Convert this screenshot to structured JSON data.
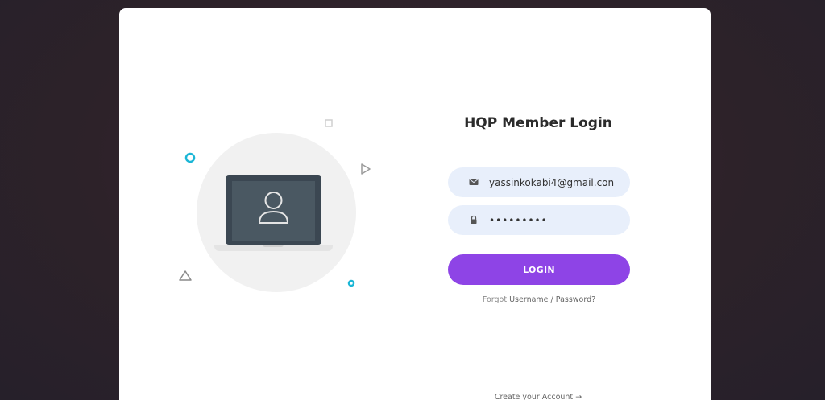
{
  "login": {
    "title": "HQP Member Login",
    "email_value": "yassinkokabi4@gmail.con",
    "password_value": "•••••••••",
    "login_label": "LOGIN",
    "forgot_prefix": "Forgot",
    "forgot_link": "Username / Password?",
    "create_account": "Create your Account",
    "create_arrow": "→"
  },
  "icons": {
    "email": "envelope-icon",
    "password": "lock-icon",
    "illustration_user": "user-icon"
  },
  "colors": {
    "accent": "#8e44e6",
    "field_bg": "#e8effb",
    "deco_cyan": "#1bb6d6",
    "background": "#2d2229"
  }
}
